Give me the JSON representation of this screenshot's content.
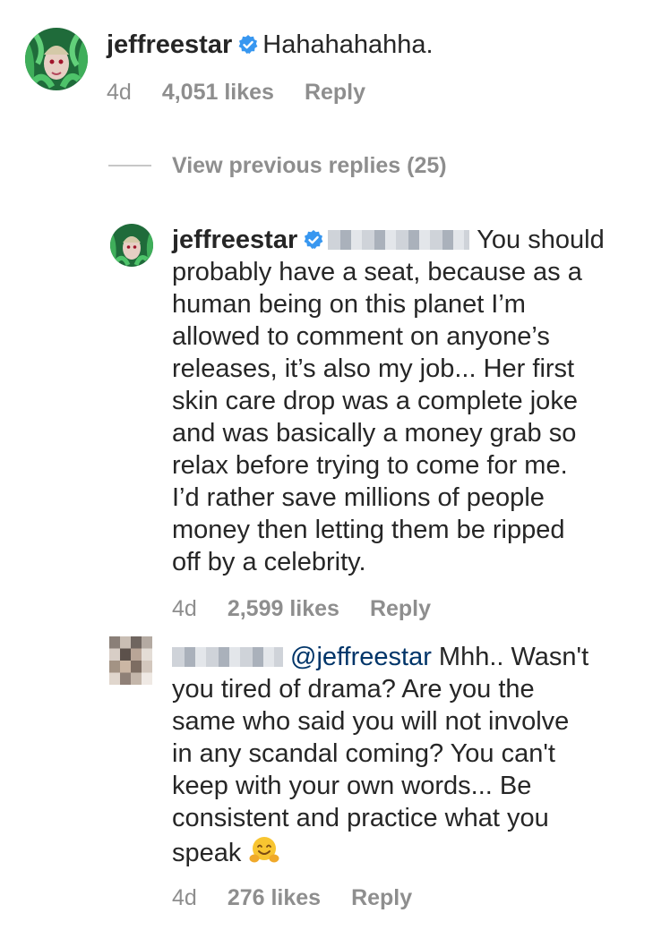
{
  "comment": {
    "username": "jeffreestar",
    "text": "Hahahahahha.",
    "age": "4d",
    "likes": "4,051 likes",
    "reply_label": "Reply"
  },
  "view_previous": "View previous replies (25)",
  "reply1": {
    "username": "jeffreestar",
    "lines": [
      "You should",
      "probably have a seat, because as a",
      "human being on this planet I’m",
      "allowed to comment on anyone’s",
      "releases, it’s also my job... Her first",
      "skin care drop was a complete joke",
      "and was basically a money grab so",
      "relax before trying to come for me.",
      "I’d rather save millions of people",
      "money then letting them be ripped",
      "off by a celebrity."
    ],
    "age": "4d",
    "likes": "2,599 likes",
    "reply_label": "Reply"
  },
  "reply2": {
    "mention": "@jeffreestar",
    "lines": [
      "Mhh.. Wasn't",
      "you tired of drama? Are you the",
      "same who said you will not involve",
      "in any scandal coming? You can't",
      "keep with your own words... Be",
      "consistent and practice what you",
      "speak"
    ],
    "emoji": "hugging-face-emoji",
    "age": "4d",
    "likes": "276 likes",
    "reply_label": "Reply"
  },
  "colors": {
    "verified": "#3897f0",
    "mention": "#003569",
    "meta": "#8e8e8e"
  }
}
